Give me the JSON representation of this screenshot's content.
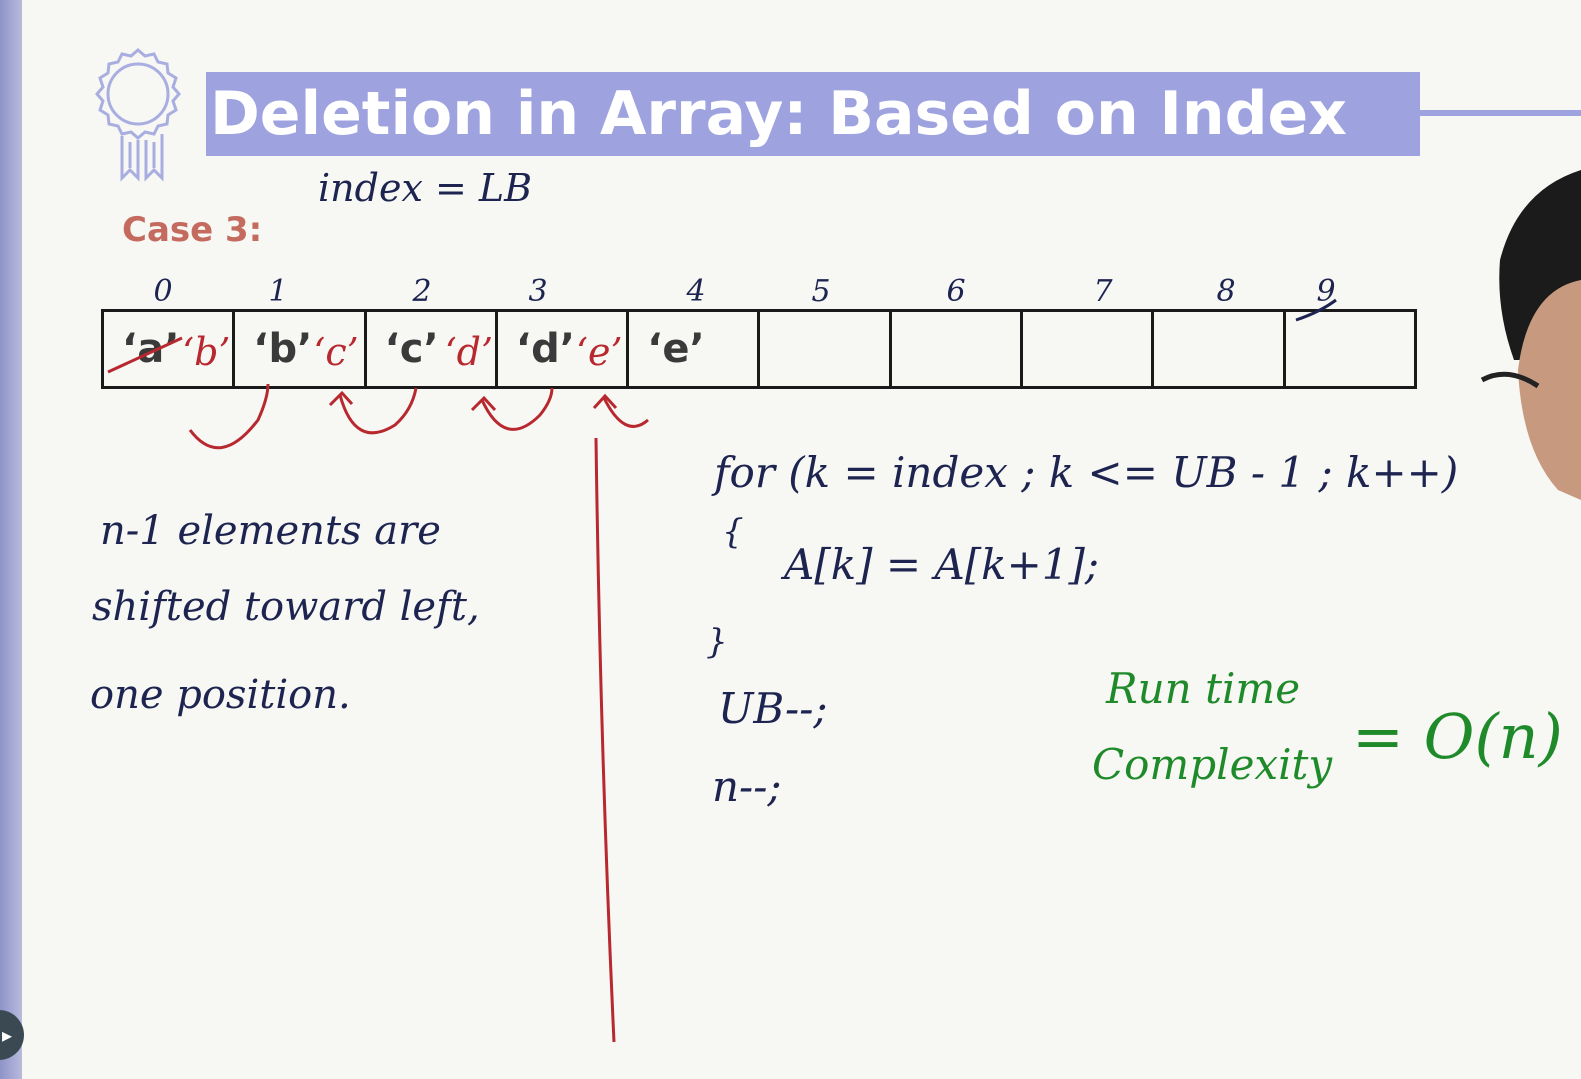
{
  "title": "Deletion in Array: Based on Index",
  "case_label": "Case 3:",
  "index_note": "index = LB",
  "array": {
    "indices": [
      "0",
      "1",
      "2",
      "3",
      "4",
      "5",
      "6",
      "7",
      "8",
      "9"
    ],
    "cells": [
      {
        "value": "‘a’",
        "new_value": "‘b’",
        "struck": true
      },
      {
        "value": "‘b’",
        "new_value": "‘c’",
        "struck": false
      },
      {
        "value": "‘c’",
        "new_value": "‘d’",
        "struck": false
      },
      {
        "value": "‘d’",
        "new_value": "‘e’",
        "struck": false
      },
      {
        "value": "‘e’",
        "new_value": "",
        "struck": false
      },
      {
        "value": "",
        "new_value": "",
        "struck": false
      },
      {
        "value": "",
        "new_value": "",
        "struck": false
      },
      {
        "value": "",
        "new_value": "",
        "struck": false
      },
      {
        "value": "",
        "new_value": "",
        "struck": false
      },
      {
        "value": "",
        "new_value": "",
        "struck": false
      }
    ]
  },
  "left_notes": [
    "n-1 elements are",
    "shifted toward left,",
    "one position."
  ],
  "code": {
    "for_line": "for (k = index ; k <= UB - 1 ; k++)",
    "open_brace": "{",
    "body": "A[k] = A[k+1];",
    "close_brace": "}",
    "ub_line": "UB--;",
    "n_line": "n--;"
  },
  "complexity": {
    "label_line1": "Run time",
    "label_line2": "Complexity",
    "value": "= O(n)"
  },
  "colors": {
    "title_bg": "#9ea3e0",
    "case_label": "#c46a5f",
    "ink_blue": "#1d2450",
    "ink_red": "#b8282f",
    "ink_green": "#1f8a2a"
  },
  "icons": {
    "badge": "award-ribbon-icon",
    "play": "play-icon"
  }
}
